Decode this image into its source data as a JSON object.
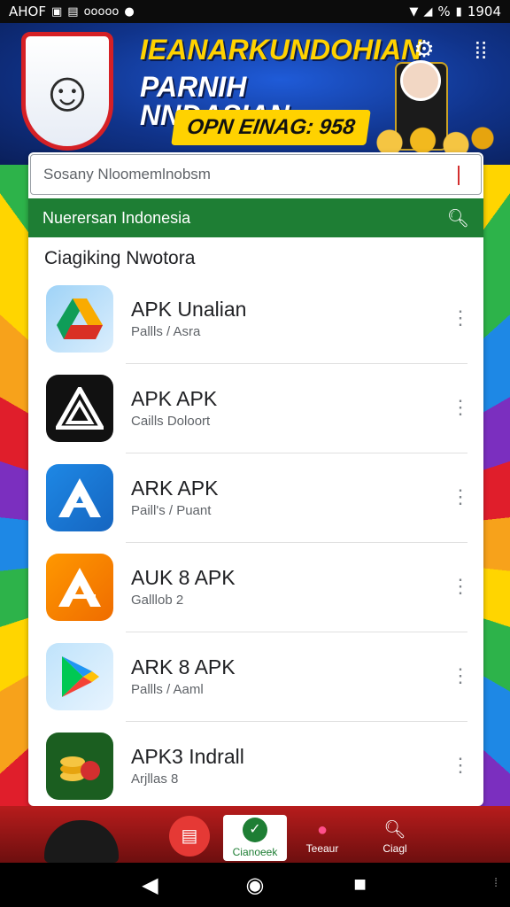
{
  "status_bar": {
    "left_text": "AHOF",
    "carrier": "ooooo",
    "battery_text": "%",
    "time": "1904"
  },
  "banner": {
    "title": "IEANARKUNDOHIAN",
    "subtitle": "PARNIH NNDASIAN",
    "promo": "OPN EINAG: 958"
  },
  "search": {
    "placeholder": "Sosany Nloomemlnobsm"
  },
  "region_bar": {
    "label": "Nuerersan Indonesia"
  },
  "section": {
    "title": "Ciagiking Nwotora"
  },
  "apps": [
    {
      "name": "APK Unalian",
      "subtitle": "Pallls / Asra",
      "icon": "drive-icon",
      "color": "#e3f2fd"
    },
    {
      "name": "APK APK",
      "subtitle": "Caills Doloort",
      "icon": "triangle-a-icon",
      "color": "#111111"
    },
    {
      "name": "ARK APK",
      "subtitle": "Paill's / Puant",
      "icon": "a-logo-icon",
      "color": "#1976d2"
    },
    {
      "name": "AUK 8 APK",
      "subtitle": "Galllob 2",
      "icon": "orange-a-icon",
      "color": "#f57c00"
    },
    {
      "name": "ARK 8 APK",
      "subtitle": "Pallls / Aaml",
      "icon": "play-icon",
      "color": "#e3f2fd"
    },
    {
      "name": "APK3 Indrall",
      "subtitle": "Arjllas 8",
      "icon": "coins-icon",
      "color": "#1b5e20"
    }
  ],
  "bottom_nav": {
    "tabs": [
      {
        "label": "",
        "icon": "home-icon"
      },
      {
        "label": "Cianoeek",
        "icon": "leaf-icon"
      },
      {
        "label": "Teeaur",
        "icon": "heart-icon"
      },
      {
        "label": "Ciagl",
        "icon": "search-icon"
      }
    ]
  },
  "colors": {
    "accent_green": "#1e7e34",
    "banner_blue": "#10338a",
    "banner_yellow": "#ffd200",
    "nav_red": "#b71c1c"
  }
}
